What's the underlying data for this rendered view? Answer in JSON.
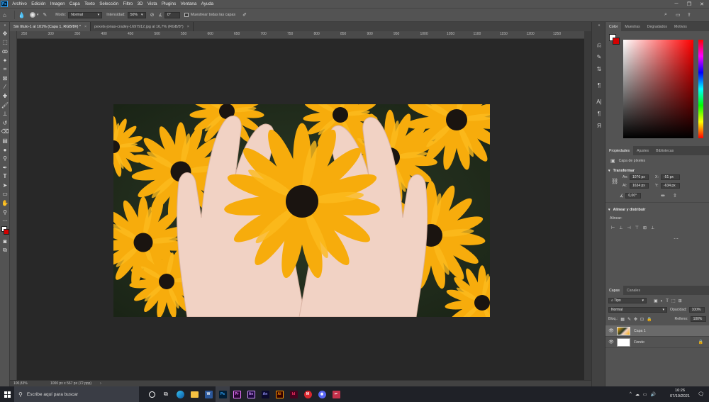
{
  "menu": {
    "items": [
      "Archivo",
      "Edición",
      "Imagen",
      "Capa",
      "Texto",
      "Selección",
      "Filtro",
      "3D",
      "Vista",
      "Plugins",
      "Ventana",
      "Ayuda"
    ]
  },
  "options_bar": {
    "mode_label": "Modo:",
    "mode_value": "Normal",
    "intensity_label": "Intensidad:",
    "intensity_value": "50%",
    "angle_value": "0°",
    "sample_all_layers": "Muestrear todas las capas"
  },
  "documents": {
    "active_tab": "Sin título-1 al 101% (Capa 1, RGB/8#) *",
    "second_tab": "pexels-jonas-cradey-1697912.jpg al 16,7% (RGB/8*)"
  },
  "ruler": {
    "ticks": [
      "250",
      "300",
      "350",
      "400",
      "450",
      "500",
      "550",
      "600",
      "650",
      "700",
      "750",
      "800",
      "850",
      "900",
      "950",
      "1000",
      "1050",
      "1100",
      "1150",
      "1200",
      "1250"
    ]
  },
  "status": {
    "zoom": "100,83%",
    "doc_info": "1000 px x 567 px (72 ppp)"
  },
  "color_panel": {
    "tabs": [
      "Color",
      "Muestras",
      "Degradados",
      "Motivos"
    ],
    "fg_color": "#ffffff",
    "bg_color": "#d40000",
    "hue": "#ff0000"
  },
  "properties_panel": {
    "tabs": [
      "Propiedades",
      "Ajustes",
      "Bibliotecas"
    ],
    "layer_type": "Capa de píxeles",
    "transform_title": "Transformar",
    "w_label": "An:",
    "w_value": "1076 px",
    "x_label": "X:",
    "x_value": "-51 px",
    "h_label": "Al:",
    "h_value": "1634 px",
    "y_label": "Y:",
    "y_value": "-634 px",
    "angle_value": "0,00°",
    "align_title": "Alinear y distribuir",
    "align_label": "Alinear:"
  },
  "layers_panel": {
    "tabs": [
      "Capas",
      "Canales"
    ],
    "filter_value": "Tipo",
    "blend_mode": "Normal",
    "opacity_label": "Opacidad:",
    "opacity_value": "100%",
    "lock_label": "Bloq.:",
    "fill_label": "Relleno:",
    "fill_value": "100%",
    "layers": [
      {
        "name": "Capa 1"
      },
      {
        "name": "Fondo"
      }
    ]
  },
  "taskbar": {
    "search_placeholder": "Escribe aquí para buscar",
    "time": "16:26",
    "date": "07/10/2021"
  }
}
